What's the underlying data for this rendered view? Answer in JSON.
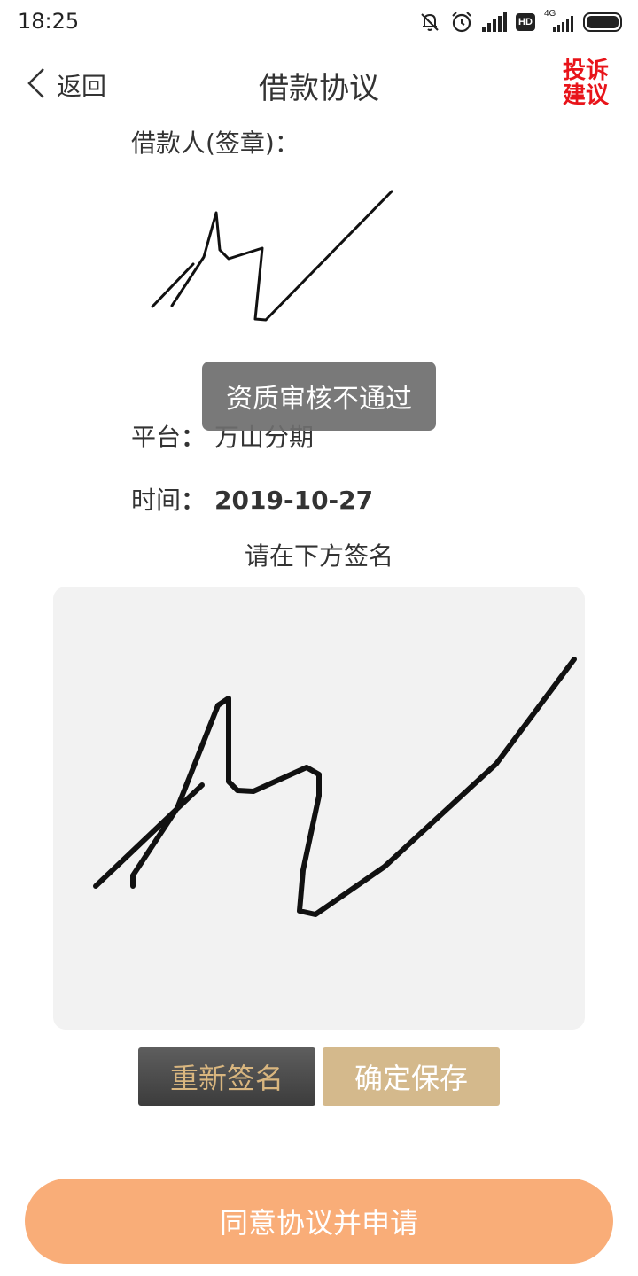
{
  "status_bar": {
    "time": "18:25",
    "hd_label": "HD",
    "network_label": "4G",
    "icons": [
      "mute-icon",
      "alarm-icon",
      "signal-icon",
      "hd-icon",
      "4g-signal-icon",
      "battery-icon"
    ]
  },
  "nav": {
    "back_label": "返回",
    "title": "借款协议",
    "complaint_label": "投诉建议",
    "complaint_color": "#e8141a"
  },
  "agreement": {
    "signer_label": "借款人(签章)：",
    "platform_key": "平台",
    "platform_value": "万山分期",
    "time_key": "时间",
    "time_value": "2019-10-27",
    "colon": "："
  },
  "toast": {
    "message": "资质审核不通过"
  },
  "sign_area": {
    "hint": "请在下方签名",
    "pad_background": "#f2f2f2"
  },
  "buttons": {
    "resign_label": "重新签名",
    "save_label": "确定保存",
    "submit_label": "同意协议并申请",
    "submit_color": "#f9ad78",
    "save_color": "#d4b98c",
    "resign_text_color": "#d9b67f"
  }
}
